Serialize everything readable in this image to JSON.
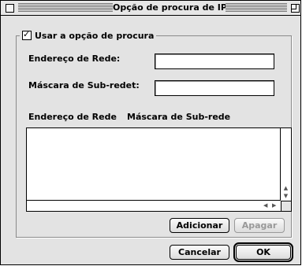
{
  "window": {
    "title": "Opção de procura de IP"
  },
  "search_option": {
    "checkbox_label": "Usar a opção de procura",
    "checked": true
  },
  "form": {
    "network_address_label": "Endereço de Rede:",
    "network_address_value": "",
    "subnet_mask_label": "Máscara de Sub-redet:",
    "subnet_mask_value": ""
  },
  "list": {
    "columns": [
      "Endereço de Rede",
      "Máscara de Sub-rede"
    ],
    "rows": []
  },
  "buttons": {
    "add": "Adicionar",
    "delete": "Apagar",
    "cancel": "Cancelar",
    "ok": "OK"
  },
  "icons": {
    "check": "✓",
    "scroll_up": "▲",
    "scroll_down": "▼",
    "scroll_left": "◀",
    "scroll_right": "▶"
  }
}
